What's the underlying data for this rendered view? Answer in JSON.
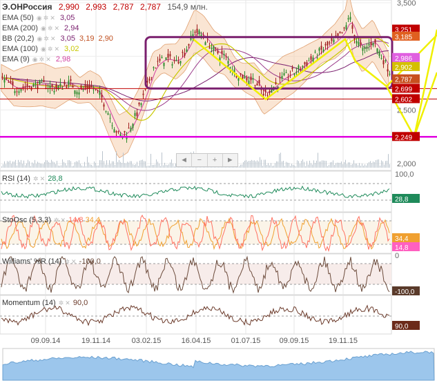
{
  "header": {
    "symbol": "Э.ОНРоссия",
    "open": "2,990",
    "high": "2,993",
    "low": "2,787",
    "close": "2,787",
    "volume": "154,9 млн."
  },
  "indicators": [
    {
      "name": "EMA (50)",
      "value": "3,05",
      "color": "#7a1f6e"
    },
    {
      "name": "EMA (200)",
      "value": "2,94",
      "color": "#7a1f6e"
    },
    {
      "name": "BB (20,2)",
      "value": "3,05",
      "value2": "3,19",
      "value3": "2,90",
      "color": "#a0522d"
    },
    {
      "name": "EMA (100)",
      "value": "3,02",
      "color": "#c8c800"
    },
    {
      "name": "EMA (9)",
      "value": "2,98",
      "color": "#d040a0"
    }
  ],
  "zoom_controls": {
    "left": "◄",
    "minus": "−",
    "plus": "+",
    "right": "►"
  },
  "price_axis_labels": [
    "3,500",
    "3,000",
    "2,500",
    "2,000"
  ],
  "price_badges": [
    {
      "label": "3,251",
      "color": "#c00000"
    },
    {
      "label": "3,185",
      "color": "#e06020"
    },
    {
      "label": "2,986",
      "color": "#e060e0"
    },
    {
      "label": "2,902",
      "color": "#d4c000"
    },
    {
      "label": "2,787",
      "color": "#c85020"
    },
    {
      "label": "2,699",
      "color": "#c00000"
    },
    {
      "label": "2,602",
      "color": "#c00000"
    },
    {
      "label": "2,249",
      "color": "#c00000"
    }
  ],
  "panes": {
    "rsi": {
      "name": "RSI (14)",
      "value": "28,8",
      "axis_top": "100,0",
      "badge": "28,8",
      "color": "#1e8a5a"
    },
    "stoch": {
      "name": "StoOsc (5,3,3)",
      "value1": "14,8",
      "value2": "34,4",
      "badge1": "34,4",
      "badge2": "14,8",
      "color1": "#ff7060",
      "color2": "#f0a030"
    },
    "williams": {
      "name": "Williams' %R (14)",
      "value": "-100,0",
      "axis_top": "0",
      "badge": "-100,0",
      "color": "#6b4a3a"
    },
    "momentum": {
      "name": "Momentum (14)",
      "value": "90,0",
      "badge": "90,0",
      "color": "#6b3a2a"
    }
  },
  "x_labels": [
    "09.09.14",
    "19.11.14",
    "03.02.15",
    "16.04.15",
    "01.07.15",
    "09.09.15",
    "19.11.15"
  ],
  "chart_data": {
    "type": "candlestick",
    "title": "Э.ОНРоссия",
    "ylim": [
      2000,
      3500
    ],
    "price": {
      "x": [
        "09.09.14",
        "19.11.14",
        "03.02.15",
        "16.04.15",
        "01.07.15",
        "09.09.15",
        "19.11.15",
        "end"
      ],
      "close": [
        2.93,
        2.88,
        2.45,
        3.1,
        2.88,
        2.78,
        3.15,
        2.79
      ]
    },
    "horizontal_levels": [
      {
        "value": 2.699,
        "color": "#c00000"
      },
      {
        "value": 2.602,
        "color": "#c00000"
      },
      {
        "value": 2.249,
        "color": "#e000e0"
      }
    ],
    "rsi": {
      "range": [
        0,
        100
      ],
      "last": 28.8
    },
    "stochastic": {
      "range": [
        0,
        100
      ],
      "k_last": 14.8,
      "d_last": 34.4
    },
    "williams_r": {
      "range": [
        -100,
        0
      ],
      "last": -100.0
    },
    "momentum": {
      "last": 90.0
    }
  }
}
